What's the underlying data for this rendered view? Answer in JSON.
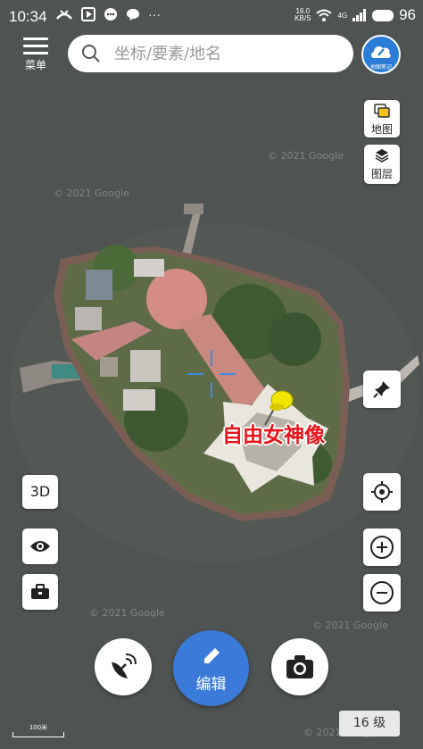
{
  "status_bar": {
    "time": "10:34",
    "net_speed_value": "16.0",
    "net_speed_unit": "KB/S",
    "network": "4G",
    "battery": "96"
  },
  "menu": {
    "label": "菜单"
  },
  "search": {
    "placeholder": "坐标/要素/地名"
  },
  "cloud": {
    "label": "地图笔记"
  },
  "right_panel": {
    "map_label": "地图",
    "layers_label": "图层"
  },
  "left_buttons": {
    "mode_3d": "3D"
  },
  "poi": {
    "name": "自由女神像"
  },
  "edit_button": {
    "label": "编辑"
  },
  "scale": {
    "label": "100米"
  },
  "zoom": {
    "level": "16 级"
  },
  "watermarks": [
    "© 2021 Google",
    "© 2021 Google",
    "© 2021 Google",
    "© 2021 Google",
    "© 2021 Google"
  ],
  "colors": {
    "accent": "#3a7ad8",
    "poi_text": "#e8141a",
    "pin": "#f2e600",
    "crosshair": "#3c8ede"
  }
}
